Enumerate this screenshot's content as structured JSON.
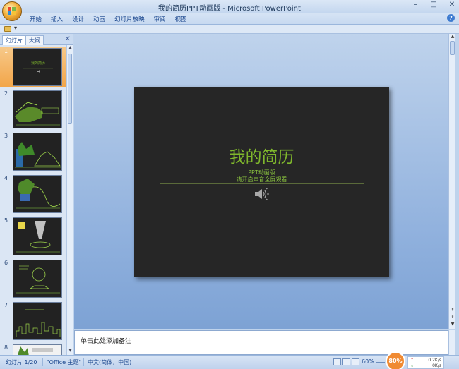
{
  "window": {
    "title": "我的简历PPT动画版 - Microsoft PowerPoint",
    "controls": [
      "–",
      "□",
      "✕"
    ]
  },
  "ribbon": {
    "tabs": [
      "开始",
      "插入",
      "设计",
      "动画",
      "幻灯片放映",
      "审阅",
      "视图"
    ]
  },
  "left_panel": {
    "tabs": [
      "幻灯片",
      "大纲"
    ],
    "close": "✕",
    "slide_numbers": [
      "1",
      "2",
      "3",
      "4",
      "5",
      "6",
      "7",
      "8"
    ],
    "selected_slide": 1
  },
  "slide": {
    "title": "我的简历",
    "subtitle_line1": "PPT动画版",
    "subtitle_line2": "请开启声音全屏观看"
  },
  "notes": {
    "placeholder": "单击此处添加备注"
  },
  "status_bar": {
    "slide_info": "幻灯片 1/20",
    "theme": "\"Office 主题\"",
    "language": "中文(简体，中国)",
    "zoom": "60%",
    "zoom_badge": "80%",
    "upload_speed": "0.2K/s",
    "download_speed": "0K/s"
  },
  "colors": {
    "slide_background": "#262626",
    "slide_title": "#7fb72c",
    "selected_thumb": "#f2a548"
  }
}
